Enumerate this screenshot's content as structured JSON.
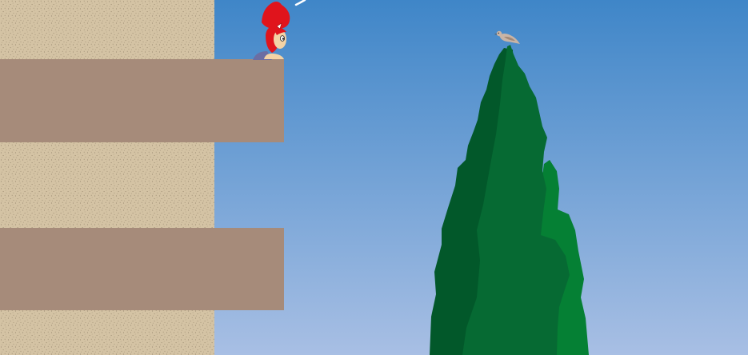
{
  "scene": {
    "sky_top": "#3f86c8",
    "sky_bottom": "#a8bfe4",
    "wall_color": "#d4c3a4",
    "wall_speckle": "#8a7a62",
    "balcony_color": "#a68b7a"
  },
  "character": {
    "hair_color": "#e0141c",
    "skin_color": "#f3d3a6",
    "clothing_color": "#6b6ea3"
  },
  "tree": {
    "dark_green": "#02582a",
    "mid_green": "#066a33",
    "light_green": "#058034"
  },
  "bird": {
    "body_color": "#c8b4a6",
    "wing_color": "#a08978"
  }
}
